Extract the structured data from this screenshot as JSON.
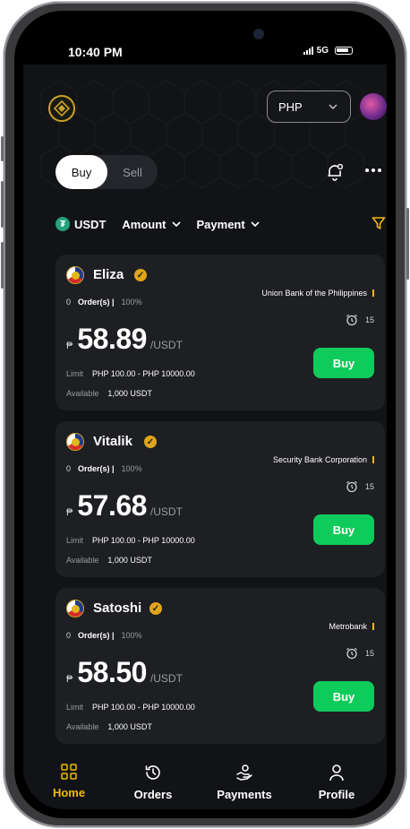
{
  "status": {
    "time": "10:40 PM",
    "network": "5G"
  },
  "header": {
    "currency": "PHP"
  },
  "trade_toggle": {
    "buy": "Buy",
    "sell": "Sell"
  },
  "filters": {
    "asset": "USDT",
    "amount": "Amount",
    "payment": "Payment"
  },
  "offers": [
    {
      "name": "Eliza",
      "orders_count": "0",
      "orders_label": "Order(s) |",
      "completion": "100%",
      "bank": "Union Bank of the Philippines",
      "time_limit": "15",
      "price": "58.89",
      "unit": "/USDT",
      "limit_label": "Limit",
      "limit": "PHP 100.00 - PHP 10000.00",
      "available_label": "Available",
      "available": "1,000 USDT",
      "buy_label": "Buy"
    },
    {
      "name": "Vitalik",
      "orders_count": "0",
      "orders_label": "Order(s) |",
      "completion": "100%",
      "bank": "Security Bank Corporation",
      "time_limit": "15",
      "price": "57.68",
      "unit": "/USDT",
      "limit_label": "Limit",
      "limit": "PHP 100.00 - PHP 10000.00",
      "available_label": "Available",
      "available": "1,000 USDT",
      "buy_label": "Buy"
    },
    {
      "name": "Satoshi",
      "orders_count": "0",
      "orders_label": "Order(s) |",
      "completion": "100%",
      "bank": "Metrobank",
      "time_limit": "15",
      "price": "58.50",
      "unit": "/USDT",
      "limit_label": "Limit",
      "limit": "PHP 100.00 - PHP 10000.00",
      "available_label": "Available",
      "available": "1,000 USDT",
      "buy_label": "Buy"
    }
  ],
  "nav": [
    {
      "label": "Home",
      "icon": "grid-icon",
      "active": true
    },
    {
      "label": "Orders",
      "icon": "clock-icon",
      "active": false
    },
    {
      "label": "Payments",
      "icon": "hand-coin-icon",
      "active": false
    },
    {
      "label": "Profile",
      "icon": "user-icon",
      "active": false
    }
  ],
  "colors": {
    "accent": "#f0b90b",
    "buy_green": "#0ecb5b",
    "card_bg": "#1e1f23",
    "screen_bg": "#121316"
  }
}
